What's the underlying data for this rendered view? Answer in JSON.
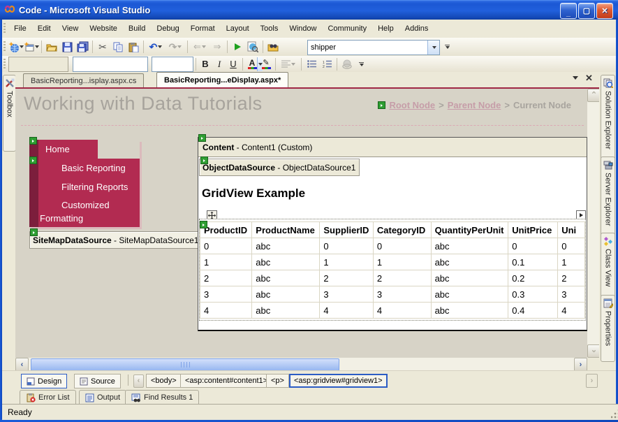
{
  "window": {
    "title": "Code - Microsoft Visual Studio"
  },
  "menubar": {
    "items": [
      "File",
      "Edit",
      "View",
      "Website",
      "Build",
      "Debug",
      "Format",
      "Layout",
      "Tools",
      "Window",
      "Community",
      "Help",
      "Addins"
    ]
  },
  "toolbar": {
    "find_value": "shipper"
  },
  "format_toolbar": {
    "bold": "B",
    "italic": "I",
    "underline": "U"
  },
  "doc_tabs": {
    "items": [
      "BasicReporting...isplay.aspx.cs",
      "BasicReporting...eDisplay.aspx*"
    ]
  },
  "left_strip": {
    "toolbox": "Toolbox"
  },
  "right_strip": {
    "tabs": [
      "Solution Explorer",
      "Server Explorer",
      "Class View",
      "Properties"
    ]
  },
  "design": {
    "masthead_title": "Working with Data Tutorials",
    "breadcrumb": {
      "root": "Root Node",
      "separator": ">",
      "parent": "Parent Node",
      "current": "Current Node"
    },
    "nav_menu": {
      "items": [
        "Home",
        "Basic Reporting",
        "Filtering Reports",
        "Customized Formatting"
      ]
    },
    "sitemapdatasource": {
      "name": "SiteMapDataSource",
      "instance": " - SiteMapDataSource1"
    },
    "content_header": {
      "name": "Content",
      "instance": " - Content1 (Custom)"
    },
    "objectdatasource": {
      "name": "ObjectDataSource",
      "instance": " - ObjectDataSource1"
    },
    "gridview": {
      "title": "GridView Example",
      "columns": [
        "ProductID",
        "ProductName",
        "SupplierID",
        "CategoryID",
        "QuantityPerUnit",
        "UnitPrice",
        "Uni"
      ],
      "rows": [
        [
          "0",
          "abc",
          "0",
          "0",
          "abc",
          "0",
          "0"
        ],
        [
          "1",
          "abc",
          "1",
          "1",
          "abc",
          "0.1",
          "1"
        ],
        [
          "2",
          "abc",
          "2",
          "2",
          "abc",
          "0.2",
          "2"
        ],
        [
          "3",
          "abc",
          "3",
          "3",
          "abc",
          "0.3",
          "3"
        ],
        [
          "4",
          "abc",
          "4",
          "4",
          "abc",
          "0.4",
          "4"
        ]
      ]
    }
  },
  "tag_navigator": {
    "design_label": "Design",
    "source_label": "Source",
    "tags": [
      "<body>",
      "<asp:content#content1>",
      "<p>",
      "<asp:gridview#gridview1>"
    ]
  },
  "bottom_panels": {
    "tabs": [
      "Error List",
      "Output",
      "Find Results 1"
    ]
  },
  "statusbar": {
    "text": "Ready"
  },
  "colors": {
    "accent_red": "#b22b51",
    "dark_red": "#7c1e3c",
    "titlebar_blue": "#1b57d4",
    "selection_blue": "#2c5cc5"
  }
}
